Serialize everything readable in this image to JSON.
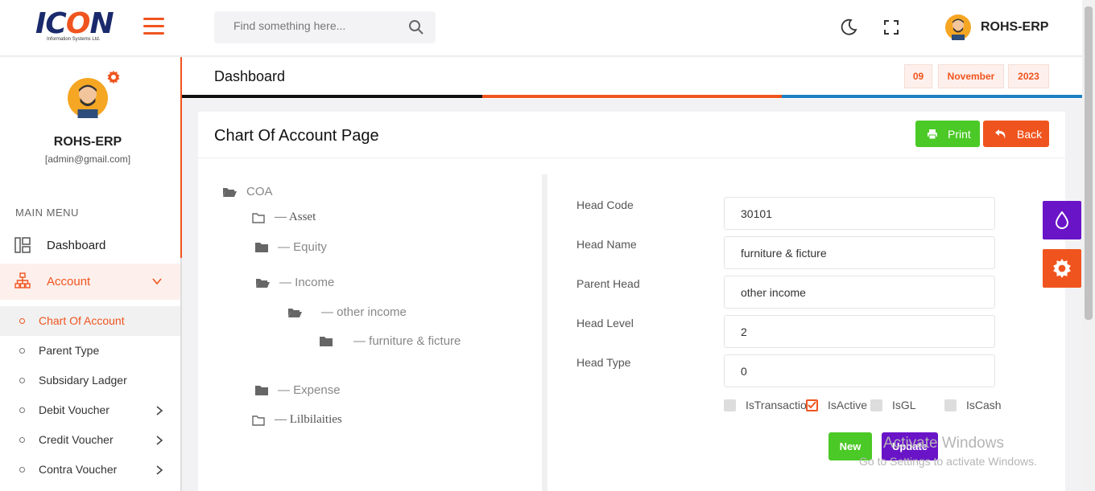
{
  "brand": {
    "logo_word_a": "IC",
    "logo_word_o": "O",
    "logo_word_b": "N",
    "logo_sub": "Information Systems Ltd."
  },
  "search": {
    "placeholder": "Find something here..."
  },
  "user": {
    "name": "ROHS-ERP",
    "email": "[admin@gmail.com]"
  },
  "sidebar": {
    "menu_title": "MAIN MENU",
    "items": [
      {
        "label": "Dashboard",
        "icon": "dashboard-icon"
      },
      {
        "label": "Account",
        "icon": "sitemap-icon"
      }
    ],
    "sub_items": [
      {
        "label": "Chart Of Account"
      },
      {
        "label": "Parent Type"
      },
      {
        "label": "Subsidary Ladger"
      },
      {
        "label": "Debit Voucher"
      },
      {
        "label": "Credit Voucher"
      },
      {
        "label": "Contra Voucher"
      }
    ]
  },
  "header": {
    "title": "Dashboard",
    "day": "09",
    "month": "November",
    "year": "2023"
  },
  "colors": {
    "accent": "#f0541e",
    "green": "#4bc926",
    "purple": "#6a14c8",
    "dark": "#111111",
    "blue": "#1e7fc2"
  },
  "page": {
    "title": "Chart Of Account Page",
    "print_label": "Print",
    "back_label": "Back"
  },
  "tree": [
    {
      "label": "COA"
    },
    {
      "label": "— Asset"
    },
    {
      "label": "— Equity"
    },
    {
      "label": "— Income"
    },
    {
      "label": "— other income"
    },
    {
      "label": "— furniture & ficture"
    },
    {
      "label": "— Expense"
    },
    {
      "label": "— Lilbilaities"
    }
  ],
  "form": {
    "head_code": {
      "label": "Head Code",
      "value": "30101"
    },
    "head_name": {
      "label": "Head Name",
      "value": "furniture & ficture"
    },
    "parent_head": {
      "label": "Parent Head",
      "value": "other income"
    },
    "head_level": {
      "label": "Head Level",
      "value": "2"
    },
    "head_type": {
      "label": "Head Type",
      "value": "0"
    },
    "checks": [
      {
        "label": "IsTransaction",
        "checked": false
      },
      {
        "label": "IsActive",
        "checked": true
      },
      {
        "label": "IsGL",
        "checked": false
      },
      {
        "label": "IsCash",
        "checked": false
      }
    ],
    "new_label": "New",
    "update_label": "Update"
  },
  "watermark": {
    "line1": "Activate Windows",
    "line2": "Go to Settings to activate Windows."
  }
}
